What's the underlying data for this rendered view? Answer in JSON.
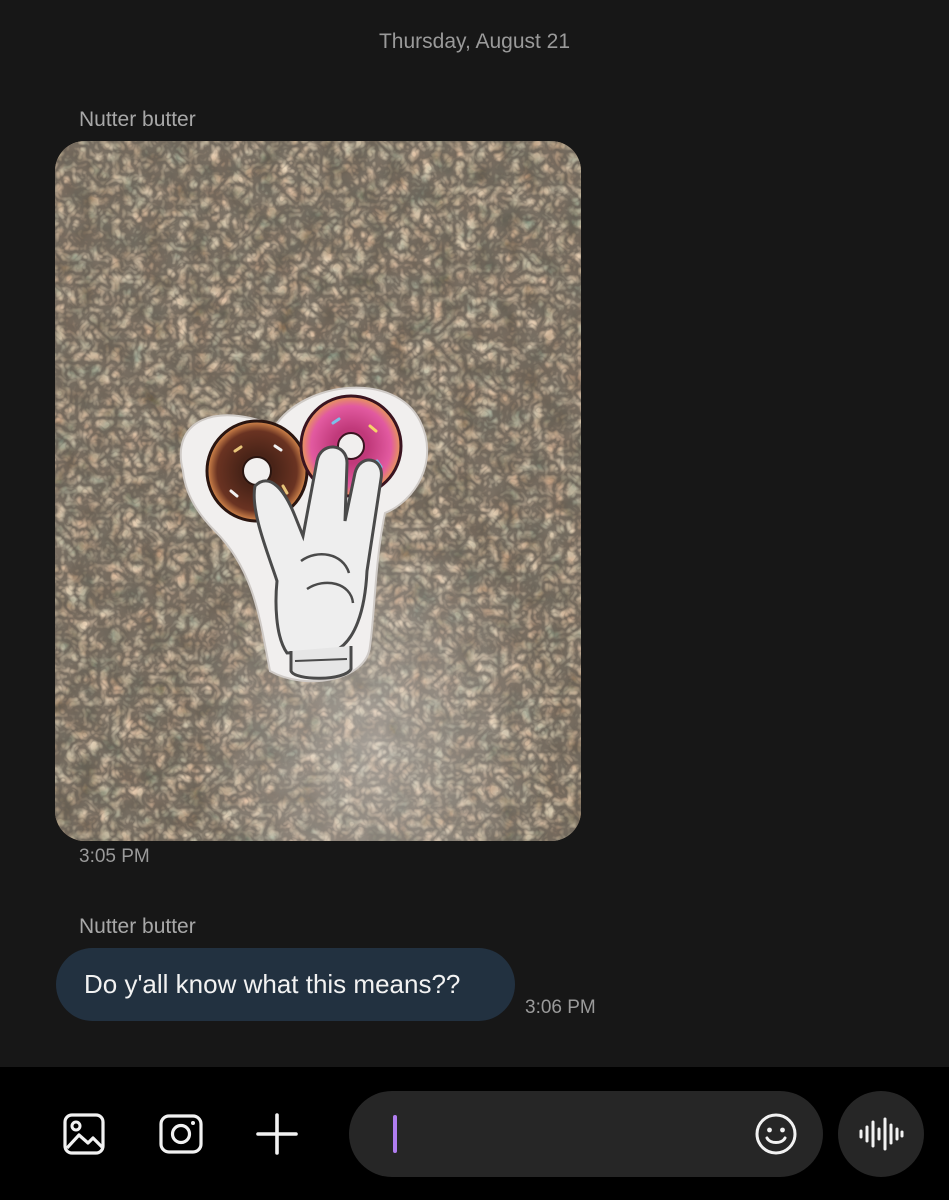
{
  "conversation": {
    "date_header": "Thursday, August 21",
    "messages": [
      {
        "sender": "Nutter butter",
        "type": "image",
        "time": "3:05 PM"
      },
      {
        "sender": "Nutter butter",
        "type": "text",
        "text": "Do y'all know what this means??",
        "time": "3:06 PM"
      }
    ]
  },
  "composer": {
    "icons": [
      "gallery-icon",
      "camera-icon",
      "plus-icon",
      "emoji-icon",
      "voice-waveform-icon"
    ],
    "input_value": "",
    "caret_color": "#b07df0"
  },
  "colors": {
    "background": "#171717",
    "bubble": "#223140",
    "composer_bar": "#000000",
    "input_pill": "#262626"
  }
}
